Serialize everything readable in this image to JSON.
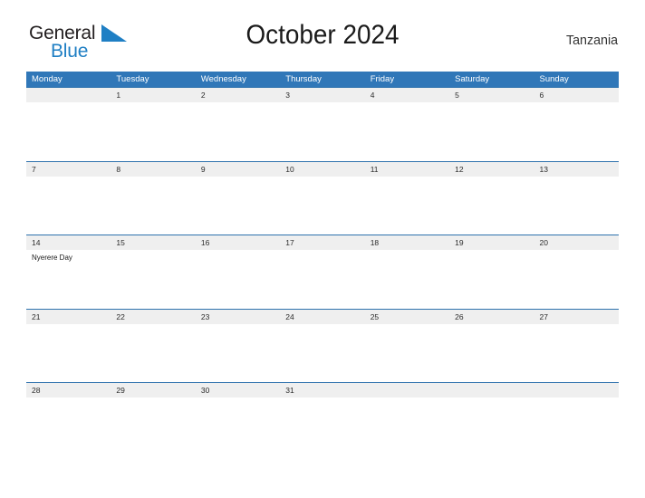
{
  "brand": {
    "name_part1": "General",
    "name_part2": "Blue",
    "mark": "blue-flag-triangle-icon",
    "accent_color": "#1f7fc4"
  },
  "header": {
    "title": "October 2024",
    "region": "Tanzania"
  },
  "colors": {
    "header_band": "#3077b8",
    "row_rule": "#2e72ad",
    "date_strip": "#efefef",
    "text": "#1a1a1a",
    "weekday_text": "#ffffff"
  },
  "calendar": {
    "weekdays": [
      "Monday",
      "Tuesday",
      "Wednesday",
      "Thursday",
      "Friday",
      "Saturday",
      "Sunday"
    ],
    "weeks": [
      {
        "days": [
          {
            "date": "",
            "events": []
          },
          {
            "date": "1",
            "events": []
          },
          {
            "date": "2",
            "events": []
          },
          {
            "date": "3",
            "events": []
          },
          {
            "date": "4",
            "events": []
          },
          {
            "date": "5",
            "events": []
          },
          {
            "date": "6",
            "events": []
          }
        ]
      },
      {
        "days": [
          {
            "date": "7",
            "events": []
          },
          {
            "date": "8",
            "events": []
          },
          {
            "date": "9",
            "events": []
          },
          {
            "date": "10",
            "events": []
          },
          {
            "date": "11",
            "events": []
          },
          {
            "date": "12",
            "events": []
          },
          {
            "date": "13",
            "events": []
          }
        ]
      },
      {
        "days": [
          {
            "date": "14",
            "events": [
              "Nyerere Day"
            ]
          },
          {
            "date": "15",
            "events": []
          },
          {
            "date": "16",
            "events": []
          },
          {
            "date": "17",
            "events": []
          },
          {
            "date": "18",
            "events": []
          },
          {
            "date": "19",
            "events": []
          },
          {
            "date": "20",
            "events": []
          }
        ]
      },
      {
        "days": [
          {
            "date": "21",
            "events": []
          },
          {
            "date": "22",
            "events": []
          },
          {
            "date": "23",
            "events": []
          },
          {
            "date": "24",
            "events": []
          },
          {
            "date": "25",
            "events": []
          },
          {
            "date": "26",
            "events": []
          },
          {
            "date": "27",
            "events": []
          }
        ]
      },
      {
        "days": [
          {
            "date": "28",
            "events": []
          },
          {
            "date": "29",
            "events": []
          },
          {
            "date": "30",
            "events": []
          },
          {
            "date": "31",
            "events": []
          },
          {
            "date": "",
            "events": []
          },
          {
            "date": "",
            "events": []
          },
          {
            "date": "",
            "events": []
          }
        ]
      }
    ]
  }
}
